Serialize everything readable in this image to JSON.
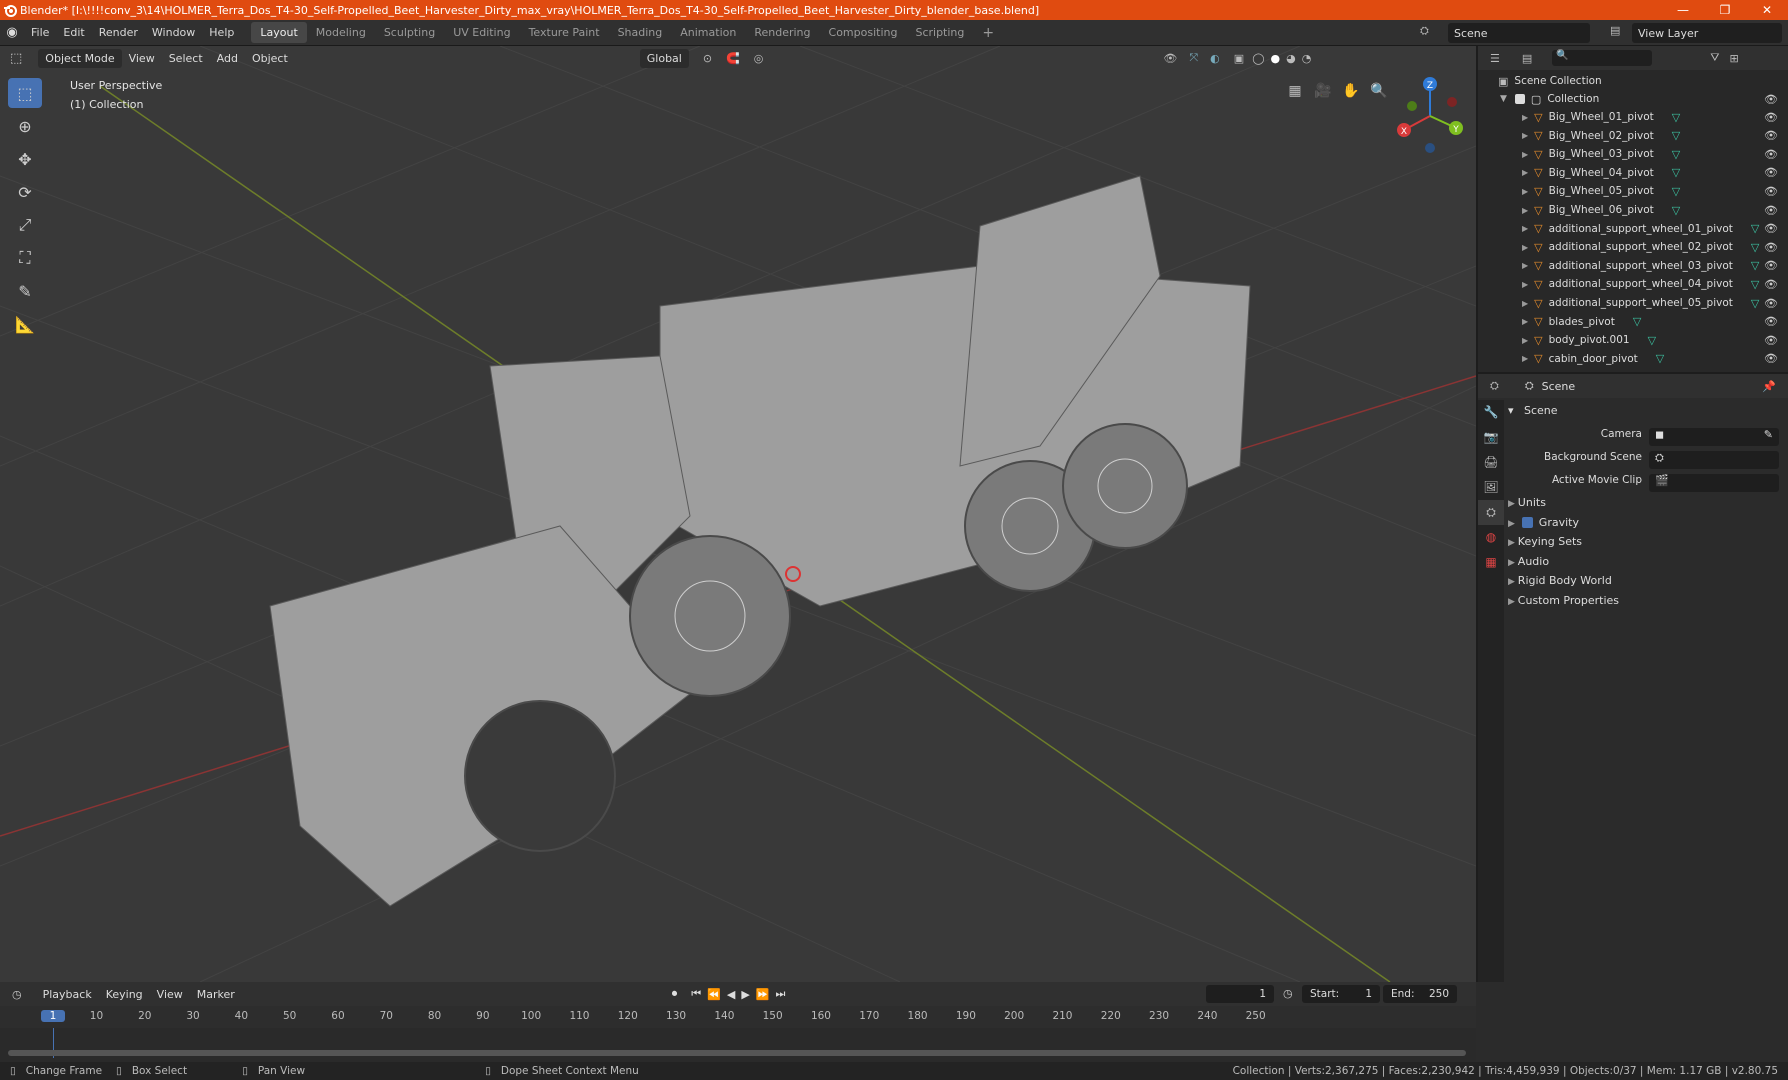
{
  "title": {
    "text": "Blender* [I:\\!!!!conv_3\\14\\HOLMER_Terra_Dos_T4-30_Self-Propelled_Beet_Harvester_Dirty_max_vray\\HOLMER_Terra_Dos_T4-30_Self-Propelled_Beet_Harvester_Dirty_blender_base.blend]",
    "min": "—",
    "max": "❐",
    "close": "✕"
  },
  "menus": [
    "File",
    "Edit",
    "Render",
    "Window",
    "Help"
  ],
  "workspaces": [
    "Layout",
    "Modeling",
    "Sculpting",
    "UV Editing",
    "Texture Paint",
    "Shading",
    "Animation",
    "Rendering",
    "Compositing",
    "Scripting"
  ],
  "scene": "Scene",
  "view_layer": "View Layer",
  "viewport": {
    "mode": "Object Mode",
    "menus": [
      "View",
      "Select",
      "Add",
      "Object"
    ],
    "transform": "Global",
    "perspective": "User Perspective",
    "collection": "(1) Collection"
  },
  "gizmo": {
    "x": "X",
    "y": "Y",
    "z": "Z"
  },
  "outliner": {
    "root": "Scene Collection",
    "collection": "Collection",
    "items": [
      "Big_Wheel_01_pivot",
      "Big_Wheel_02_pivot",
      "Big_Wheel_03_pivot",
      "Big_Wheel_04_pivot",
      "Big_Wheel_05_pivot",
      "Big_Wheel_06_pivot",
      "additional_support_wheel_01_pivot",
      "additional_support_wheel_02_pivot",
      "additional_support_wheel_03_pivot",
      "additional_support_wheel_04_pivot",
      "additional_support_wheel_05_pivot",
      "blades_pivot",
      "body_pivot.001",
      "cabin_door_pivot"
    ]
  },
  "properties": {
    "header": "Scene",
    "section": "Scene",
    "camera_label": "Camera",
    "bg_label": "Background Scene",
    "clip_label": "Active Movie Clip",
    "panels": [
      "Units",
      "Gravity",
      "Keying Sets",
      "Audio",
      "Rigid Body World",
      "Custom Properties"
    ]
  },
  "timeline": {
    "menus": [
      "Playback",
      "Keying",
      "View",
      "Marker"
    ],
    "current_frame": "1",
    "start_label": "Start:",
    "start": "1",
    "end_label": "End:",
    "end": "250",
    "ticks": [
      "1",
      "10",
      "20",
      "30",
      "40",
      "50",
      "60",
      "70",
      "80",
      "90",
      "100",
      "110",
      "120",
      "130",
      "140",
      "150",
      "160",
      "170",
      "180",
      "190",
      "200",
      "210",
      "220",
      "230",
      "240",
      "250"
    ]
  },
  "status": {
    "change_frame": "Change Frame",
    "box_select": "Box Select",
    "pan_view": "Pan View",
    "context": "Dope Sheet Context Menu",
    "stats": "Collection | Verts:2,367,275 | Faces:2,230,942 | Tris:4,459,939 | Objects:0/37 | Mem: 1.17 GB | v2.80.75"
  }
}
